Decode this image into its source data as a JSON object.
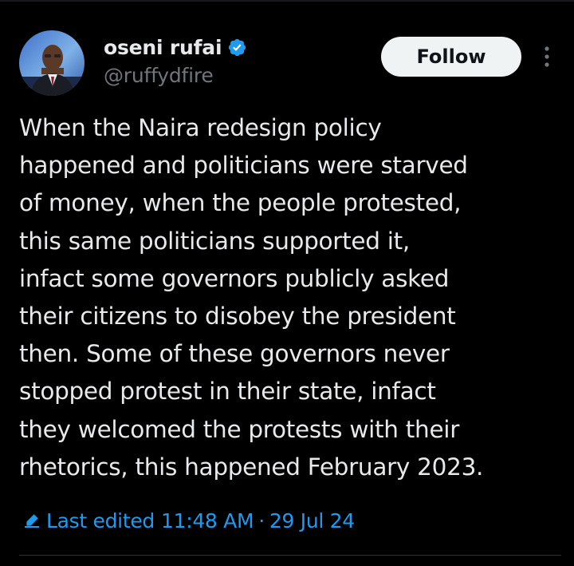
{
  "author": {
    "display_name": "oseni rufai",
    "handle": "@ruffydfire",
    "verified": true,
    "verified_color": "#1d9bf0"
  },
  "actions": {
    "follow_label": "Follow"
  },
  "tweet": {
    "text": "When the Naira redesign policy\nhappened and politicians were starved\nof money, when the people protested,\nthis same politicians supported it,\ninfact some governors publicly asked\ntheir citizens to disobey the president\nthen. Some of these governors never\nstopped protest in their state, infact\nthey welcomed the protests with their\nrhetorics, this happened February 2023."
  },
  "edit_info": {
    "label": "Last edited",
    "time": "11:48 AM",
    "separator": "·",
    "date": "29 Jul 24",
    "color": "#1d9bf0"
  },
  "icons": {
    "verified": "verified-badge-icon",
    "more": "more-vertical-icon",
    "edit": "pencil-edit-icon"
  },
  "theme": {
    "background": "#000000",
    "text": "#e7e9ea",
    "muted": "#71767b",
    "button_bg": "#eff3f4"
  }
}
